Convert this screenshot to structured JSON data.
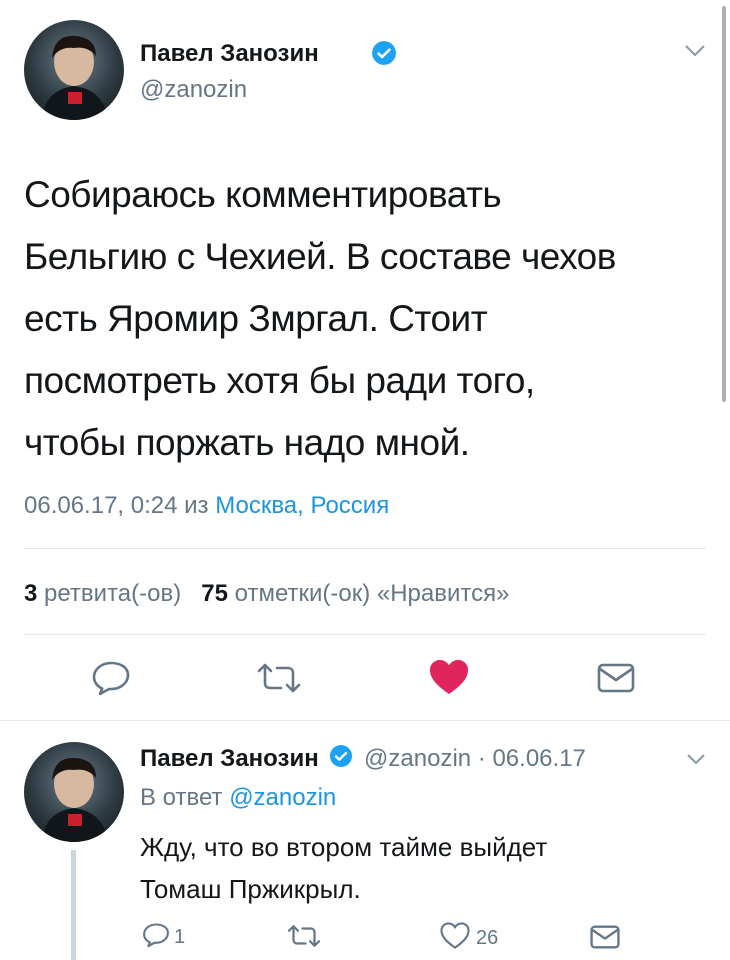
{
  "main_tweet": {
    "author_name": "Павел Занозин",
    "author_handle": "@zanozin",
    "text_lines": [
      "Собираюсь комментировать",
      "Бельгию с Чехией. В составе чехов",
      "есть Яромир Змргал. Стоит",
      "посмотреть хотя бы ради того,",
      "чтобы поржать надо мной."
    ],
    "timestamp": "06.06.17, 0:24 из",
    "location": "Москва, Россия",
    "retweets_count": "3",
    "retweets_label": "ретвита(-ов)",
    "likes_count": "75",
    "likes_label": "отметки(-ок) «Нравится»"
  },
  "reply_tweet": {
    "author_name": "Павел Занозин",
    "handle_date": "@zanozin · 06.06.17",
    "reply_prefix": "В ответ",
    "reply_to": "@zanozin",
    "text_lines": [
      "Жду, что во втором тайме выйдет",
      "Томаш Пржикрыл."
    ],
    "reply_count": "1",
    "like_count": "26"
  },
  "colors": {
    "text": "#14171a",
    "secondary": "#657786",
    "link": "#1b95e0",
    "like_active": "#e0245e",
    "divider": "#e1e8ed"
  },
  "icons": [
    "verified-icon",
    "chevron-down-icon",
    "reply-icon",
    "retweet-icon",
    "heart-icon",
    "mail-icon"
  ]
}
